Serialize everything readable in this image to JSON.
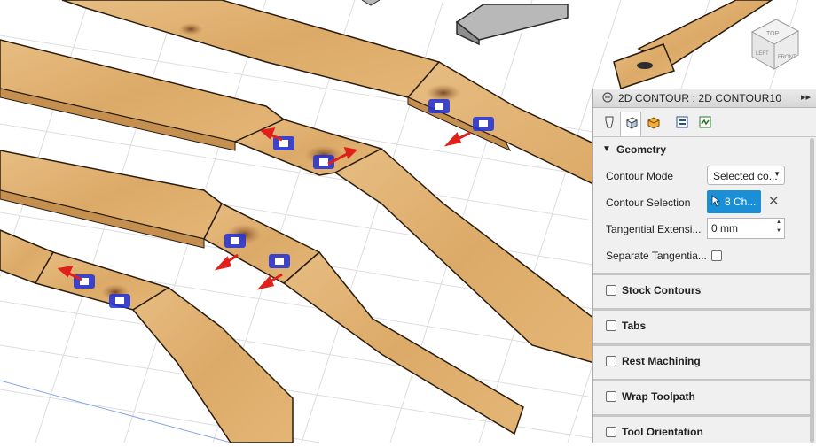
{
  "panel": {
    "title": "2D CONTOUR : 2D CONTOUR10",
    "expand_icon": "double-chevron-right-icon",
    "tabs": [
      {
        "name": "tool-tab",
        "icon": "tool-icon",
        "active": false
      },
      {
        "name": "geometry-tab",
        "icon": "geometry-cube-icon",
        "active": true
      },
      {
        "name": "heights-tab",
        "icon": "heights-icon",
        "active": false
      },
      {
        "name": "passes-tab",
        "icon": "passes-icon",
        "active": false
      },
      {
        "name": "linking-tab",
        "icon": "linking-icon",
        "active": false
      }
    ],
    "geometry": {
      "header": "Geometry",
      "contour_mode_label": "Contour Mode",
      "contour_mode_value": "Selected co...",
      "contour_selection_label": "Contour Selection",
      "contour_selection_value": "8 Ch...",
      "tangential_label": "Tangential Extensi...",
      "tangential_value": "0 mm",
      "separate_label": "Separate Tangentia..."
    },
    "sections": [
      {
        "label": "Stock Contours"
      },
      {
        "label": "Tabs"
      },
      {
        "label": "Rest Machining"
      },
      {
        "label": "Wrap Toolpath"
      },
      {
        "label": "Tool Orientation"
      }
    ]
  },
  "viewcube": {
    "faces": [
      "TOP",
      "LEFT",
      "FRONT"
    ]
  },
  "colors": {
    "wood": "#d9a865",
    "wood_top": "#e3b577",
    "wood_edge": "#3a2a18",
    "grid": "#d9d9d9",
    "selection": "#1a8fd6",
    "arrow": "#e0201a",
    "contour_marker": "#2030d8"
  }
}
